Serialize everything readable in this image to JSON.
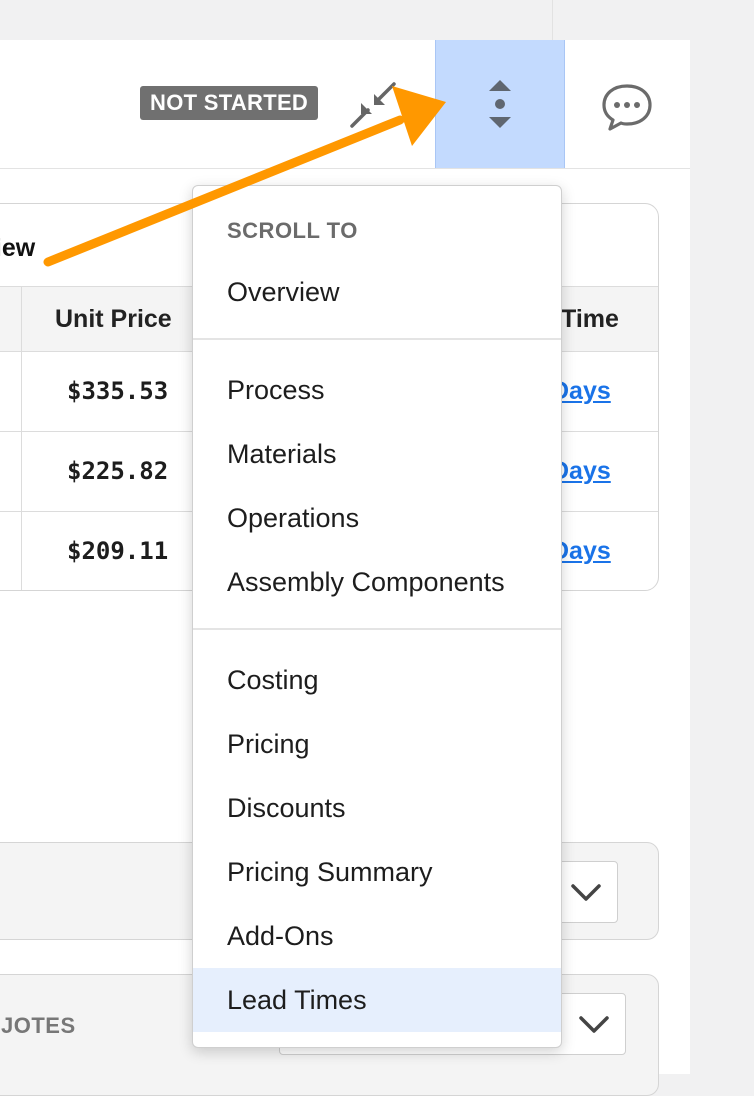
{
  "header": {
    "status_badge": "NOT STARTED"
  },
  "overview_card": {
    "title_fragment": "view",
    "columns": {
      "unit_price": "Unit Price",
      "lead_time_fragment": "Time"
    },
    "rows": [
      {
        "unit_price": "$335.53",
        "lead_time_fragment": "Days"
      },
      {
        "unit_price": "$225.82",
        "lead_time_fragment": "Days"
      },
      {
        "unit_price": "$209.11",
        "lead_time_fragment": "Days"
      }
    ]
  },
  "sections": {
    "quotes_label_fragment": "JOTES"
  },
  "scroll_menu": {
    "heading": "SCROLL TO",
    "group1": [
      "Overview"
    ],
    "group2": [
      "Process",
      "Materials",
      "Operations",
      "Assembly Components"
    ],
    "group3": [
      "Costing",
      "Pricing",
      "Discounts",
      "Pricing Summary",
      "Add-Ons",
      "Lead Times"
    ],
    "highlighted": "Lead Times"
  },
  "colors": {
    "accent_arrow": "#ff9800",
    "active_button": "#c3dafe",
    "link": "#1a73e8",
    "badge_bg": "#707070"
  }
}
